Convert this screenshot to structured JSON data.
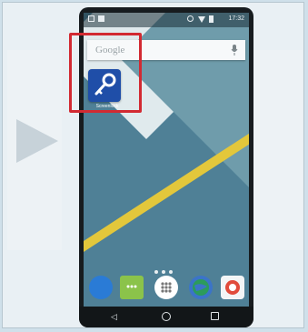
{
  "statusbar": {
    "time": "17:32",
    "icons": [
      "notification-icon",
      "notification-icon",
      "block-icon",
      "wifi-icon",
      "battery-icon"
    ]
  },
  "search": {
    "brand": "Google",
    "icon": "mic-icon"
  },
  "app": {
    "label": "Screenlock",
    "icon": "key-icon",
    "accent": "#1f4ea8"
  },
  "dock": {
    "icons": [
      "phone-icon",
      "messaging-icon",
      "apps-drawer-icon",
      "browser-icon",
      "camera-icon"
    ]
  },
  "navbar": {
    "buttons": [
      "back",
      "home",
      "recents"
    ]
  },
  "highlight": {
    "color": "#d22a32"
  }
}
